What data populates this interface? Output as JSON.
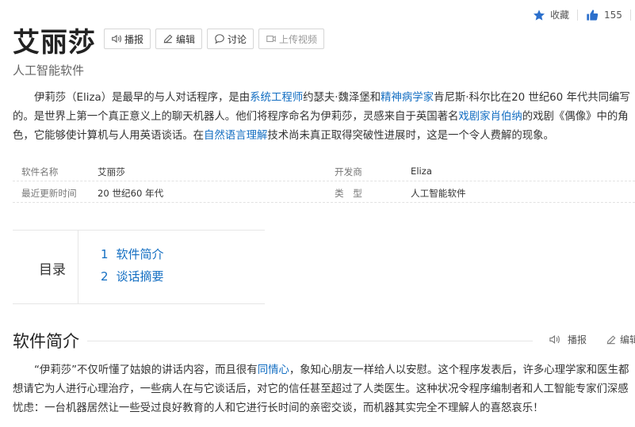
{
  "header": {
    "favorite_label": "收藏",
    "like_count": "155",
    "title": "艾丽莎",
    "subtitle": "人工智能软件",
    "tools": [
      {
        "label": "播报",
        "icon": "speaker-icon"
      },
      {
        "label": "编辑",
        "icon": "pencil-icon"
      },
      {
        "label": "讨论",
        "icon": "chat-bubble-icon"
      },
      {
        "label": "上传视频",
        "icon": "video-icon"
      }
    ]
  },
  "intro": {
    "t1": "伊莉莎（Eliza）是最早的与人对话程序，是由",
    "link1": "系统工程师",
    "t2": "约瑟夫·魏泽堡和",
    "link2": "精神病学家",
    "t3": "肯尼斯·科尔比在20 世纪60 年代共同编写的。是世界上第一个真正意义上的聊天机器人。他们将程序命名为伊莉莎，灵感来自于英国著名",
    "link3": "戏剧家",
    "link4": "肖伯纳",
    "t4": "的戏剧《偶像》中的角色，它能够使计算机与人用英语谈话。在",
    "link5": "自然语言理解",
    "t5": "技术尚未真正取得突破性进展时，这是一个令人费解的现象。"
  },
  "info": [
    {
      "k1": "软件名称",
      "v1": "艾丽莎",
      "k2": "开发商",
      "v2": "Eliza"
    },
    {
      "k1": "最近更新时间",
      "v1": "20 世纪60 年代",
      "k2": "类　型",
      "v2": "人工智能软件"
    }
  ],
  "catalog": {
    "title": "目录",
    "items": [
      {
        "num": "1",
        "label": "软件简介"
      },
      {
        "num": "2",
        "label": "谈话摘要"
      }
    ]
  },
  "section": {
    "title": "软件简介",
    "broadcast_label": "播报",
    "edit_label": "编辑",
    "p1": "“伊莉莎”不仅听懂了姑娘的讲话内容，而且很有",
    "link": "同情心",
    "p2": "，象知心朋友一样给人以安慰。这个程序发表后，许多心理学家和医生都想请它为人进行心理治疗，一些病人在与它谈话后，对它的信任甚至超过了人类医生。这种状况令程序编制者和人工智能专家们深感忧虑：一台机器居然让一些受过良好教育的人和它进行长时间的亲密交谈，而机器其实完全不理解人的喜怒哀乐！"
  },
  "colors": {
    "link": "#136ec2",
    "like_icon": "#2b6fcc"
  }
}
